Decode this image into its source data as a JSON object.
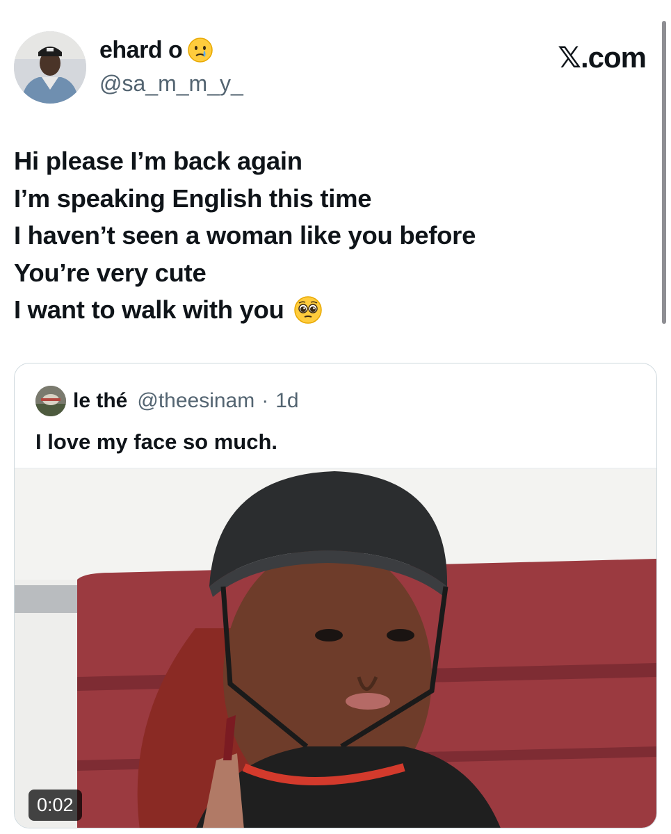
{
  "author": {
    "display_name": "ehard o",
    "name_emoji": "crying-face-emoji",
    "handle": "@sa_m_m_y_"
  },
  "brand": "𝕏.com",
  "tweet": {
    "lines": [
      "Hi please I’m back again",
      "I’m speaking English this time",
      "I haven’t seen a woman like you before",
      "You’re very cute",
      "I want to walk with you"
    ],
    "trailing_emoji": "pleading-face-emoji"
  },
  "quoted": {
    "display_name": "le thé",
    "handle": "@theesinam",
    "separator": "·",
    "time": "1d",
    "text": "I love my face so much.",
    "media": {
      "type": "video",
      "duration": "0:02"
    }
  },
  "colors": {
    "text_primary": "#0f1419",
    "text_secondary": "#536471",
    "card_border": "#cfd9de",
    "seat_red": "#9b3a40",
    "helmet": "#2b2d2f"
  }
}
